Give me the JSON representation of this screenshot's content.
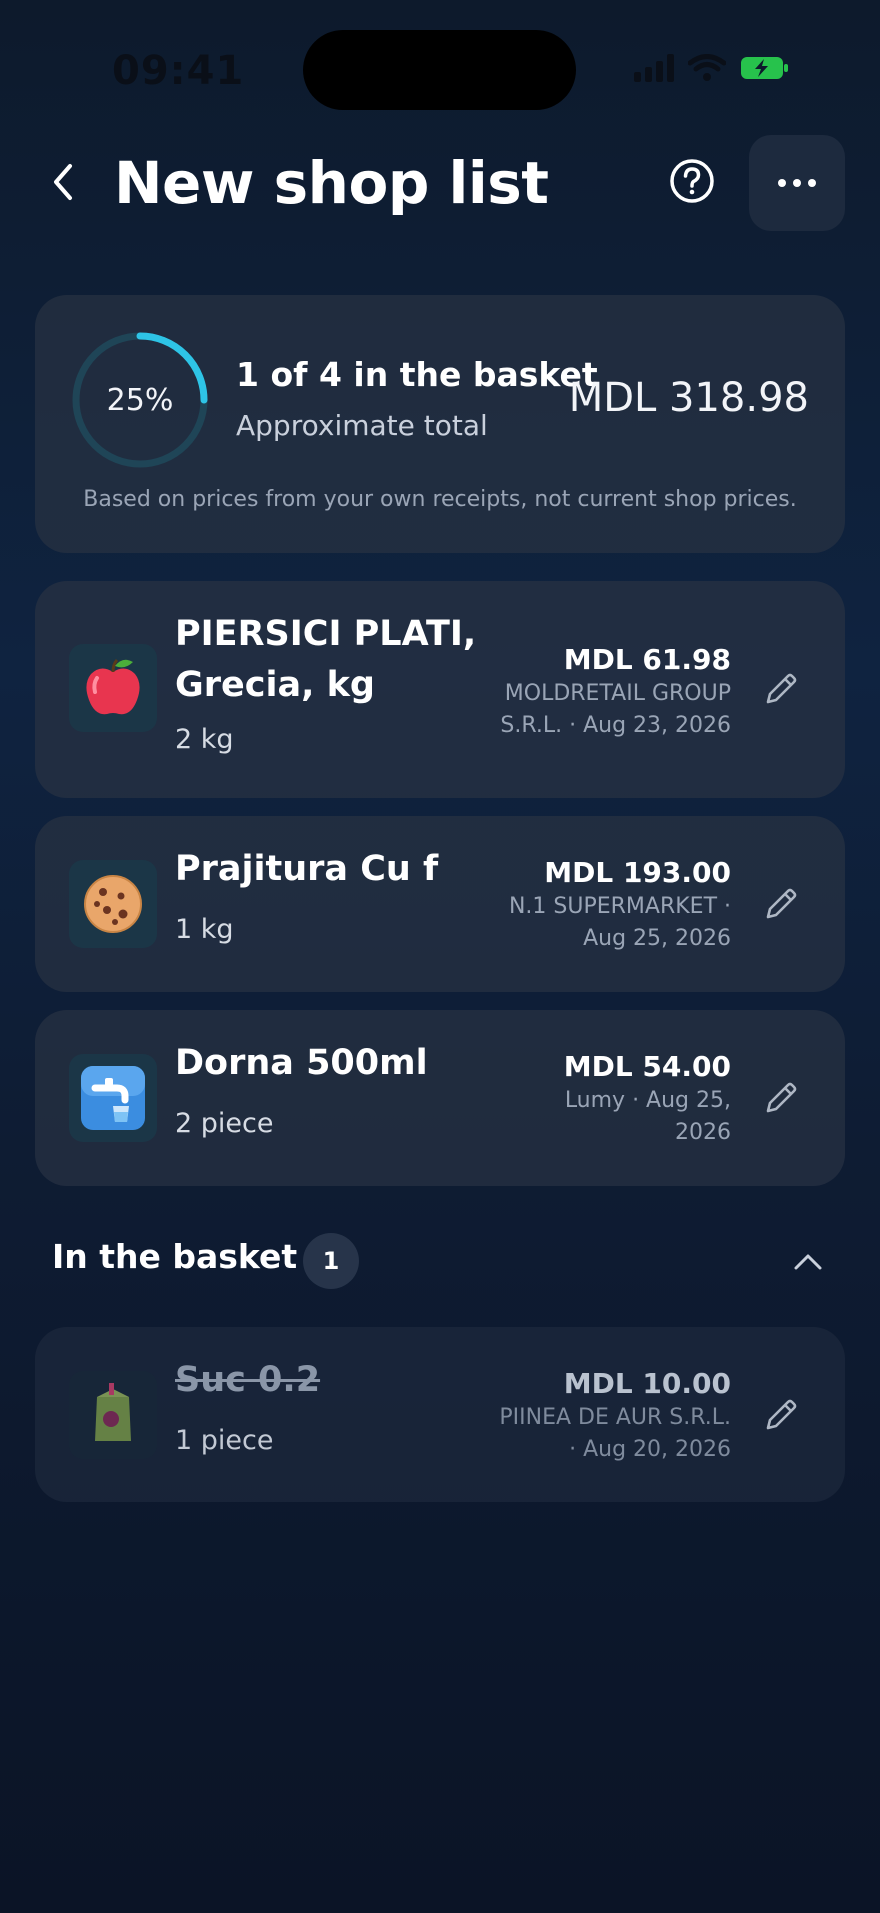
{
  "status_bar": {
    "time": "09:41"
  },
  "header": {
    "title": "New shop list"
  },
  "summary": {
    "progress_percent_label": "25%",
    "progress_fraction": 0.25,
    "basket_count_text": "1 of 4 in the basket",
    "approx_label": "Approximate total",
    "total_value": "MDL 318.98",
    "note": "Based on prices from your own receipts, not current shop prices."
  },
  "items": [
    {
      "icon": "apple-icon",
      "name_line1": "PIERSICI PLATI,",
      "name_line2": "Grecia, kg",
      "qty": "2 kg",
      "price": "MDL 61.98",
      "store_line1": "MOLDRETAIL GROUP",
      "store_line2": "S.R.L. · Aug 23, 2026"
    },
    {
      "icon": "cookie-icon",
      "name_line1": "Prajitura Cu f",
      "qty": "1 kg",
      "price": "MDL 193.00",
      "store_line1": "N.1 SUPERMARKET ·",
      "store_line2": "Aug 25, 2026"
    },
    {
      "icon": "water-tap-icon",
      "name_line1": "Dorna 500ml",
      "qty": "2 piece",
      "price": "MDL 54.00",
      "store_line1": "Lumy · Aug 25,",
      "store_line2": "2026"
    }
  ],
  "basket_section": {
    "title": "In the basket",
    "count": "1",
    "items": [
      {
        "icon": "juice-box-icon",
        "name_line1": "Suc 0.2",
        "qty": "1 piece",
        "price": "MDL 10.00",
        "store_line1": "PIINEA DE AUR S.R.L.",
        "store_line2": "· Aug 20, 2026"
      }
    ]
  },
  "colors": {
    "accent": "#2ec4e6",
    "ring_track": "#1f4557",
    "battery": "#27c24c"
  }
}
